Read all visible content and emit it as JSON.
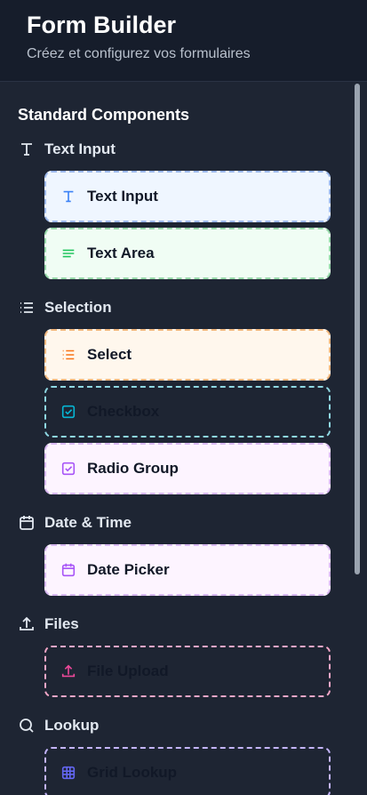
{
  "app": {
    "title": "Form Builder",
    "subtitle": "Créez et configurez vos formulaires"
  },
  "panel": {
    "heading": "Standard Components",
    "categories": [
      {
        "label": "Text Input",
        "icon": "text-icon",
        "items": [
          {
            "label": "Text Input",
            "icon": "text-icon",
            "bg": "#eff6ff",
            "border": "#9bb7ea",
            "iconColor": "#3b82f6"
          },
          {
            "label": "Text Area",
            "icon": "lines-icon",
            "bg": "#f0fdf4",
            "border": "#95d8a8",
            "iconColor": "#22c55e"
          }
        ]
      },
      {
        "label": "Selection",
        "icon": "list-icon",
        "items": [
          {
            "label": "Select",
            "icon": "list-icon",
            "bg": "#fff7ed",
            "border": "#f1b77d",
            "iconColor": "#f97316"
          },
          {
            "label": "Checkbox",
            "icon": "checkbox-icon",
            "bg": "transparent",
            "border": "#8fd8e3",
            "iconColor": "#06b6d4"
          },
          {
            "label": "Radio Group",
            "icon": "checkbox-icon",
            "bg": "#fdf4ff",
            "border": "#d7b7f0",
            "iconColor": "#a855f7"
          }
        ]
      },
      {
        "label": "Date & Time",
        "icon": "calendar-icon",
        "items": [
          {
            "label": "Date Picker",
            "icon": "calendar-icon",
            "bg": "#fdf4ff",
            "border": "#d7b7f0",
            "iconColor": "#a855f7"
          }
        ]
      },
      {
        "label": "Files",
        "icon": "upload-icon",
        "items": [
          {
            "label": "File Upload",
            "icon": "upload-icon",
            "bg": "transparent",
            "border": "#f4a7c8",
            "iconColor": "#ec4899"
          }
        ]
      },
      {
        "label": "Lookup",
        "icon": "search-icon",
        "items": [
          {
            "label": "Grid Lookup",
            "icon": "grid-icon",
            "bg": "transparent",
            "border": "#c4b5fd",
            "iconColor": "#6366f1"
          }
        ]
      }
    ]
  }
}
